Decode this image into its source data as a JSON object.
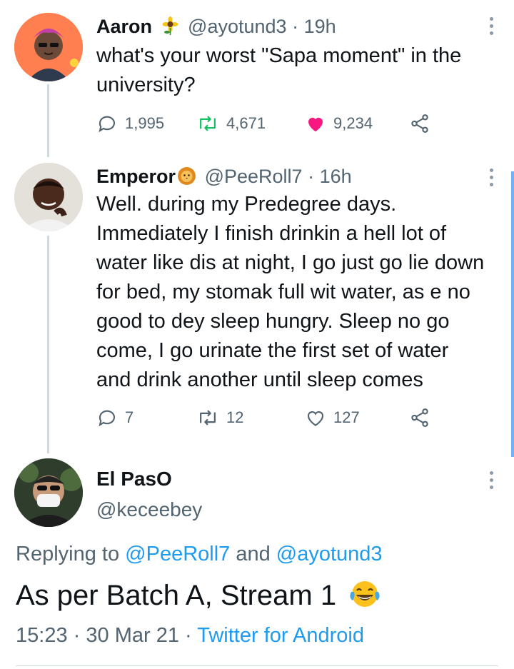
{
  "tweets": [
    {
      "name": "Aaron",
      "badge_icon": "sunflower-emoji",
      "handle": "@ayotund3",
      "separator": "·",
      "time": "19h",
      "text_lines": [
        "what's your worst \"Sapa moment\" in the",
        "university?"
      ],
      "replies": "1,995",
      "retweets": "4,671",
      "likes": "9,234",
      "liked": true
    },
    {
      "name": "Emperor",
      "badge_icon": "lion-emoji",
      "handle": "@PeeRoll7",
      "separator": "·",
      "time": "16h",
      "text_lines": [
        "Well. during my Predegree days.",
        "Immediately I finish drinkin a hell lot of",
        "water like dis at night, I go just go lie down",
        "for bed, my stomak full wit water, as e no",
        "good to dey sleep hungry. Sleep no go",
        "come, I go urinate the first set of water",
        "and drink another until sleep comes"
      ],
      "replies": "7",
      "retweets": "12",
      "likes": "127",
      "liked": false
    }
  ],
  "main": {
    "name": "El PasO",
    "handle": "@keceebey",
    "replying_prefix": "Replying to",
    "replying_to": [
      "@PeeRoll7",
      "@ayotund3"
    ],
    "replying_join": "and",
    "text": "As per Batch A, Stream 1",
    "text_emoji": "face-with-tears-of-joy-emoji",
    "time": "15:23",
    "date": "30 Mar 21",
    "separator": "·",
    "source": "Twitter for Android"
  },
  "colors": {
    "accent": "#1d9bf0",
    "like": "#f91880",
    "muted": "#536471",
    "retweet": "#17bf63"
  }
}
